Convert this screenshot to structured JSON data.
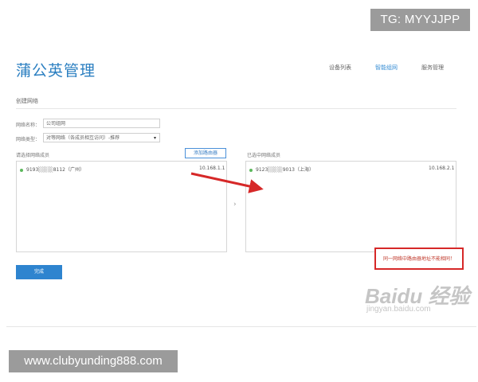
{
  "overlay": {
    "tg_label": "TG: MYYJJPP",
    "url_label": "www.clubyunding888.com"
  },
  "header": {
    "title": "蒲公英管理",
    "nav": [
      {
        "label": "设备列表",
        "active": false
      },
      {
        "label": "智能组网",
        "active": true
      },
      {
        "label": "服务管理",
        "active": false
      }
    ]
  },
  "form": {
    "section_title": "创建网络",
    "network_name_label": "网络名称：",
    "network_name_value": "公司组网",
    "network_type_label": "网络类型：",
    "network_type_value": "对等网络（各成员相互访问）-推荐",
    "available_label": "请选择网络成员",
    "add_router_button": "添加路由器",
    "selected_label": "已选中网络成员",
    "done_button": "完成"
  },
  "available_members": [
    {
      "name": "9193░░░░8112（广州）",
      "ip": "10.168.1.1"
    }
  ],
  "selected_members": [
    {
      "name": "9123░░░░9013（上海）",
      "ip": "10.168.2.1"
    }
  ],
  "annotation": {
    "warning_text": "同一网络中路由器地址不能相同！",
    "arrow_color": "#d62828",
    "box_color": "#d62828"
  },
  "watermark": {
    "brand": "Baidu 经验",
    "sub": "jingyan.baidu.com"
  },
  "colors": {
    "accent": "#2e84cf",
    "title": "#2b7fc1",
    "status_online": "#5cb85c"
  }
}
